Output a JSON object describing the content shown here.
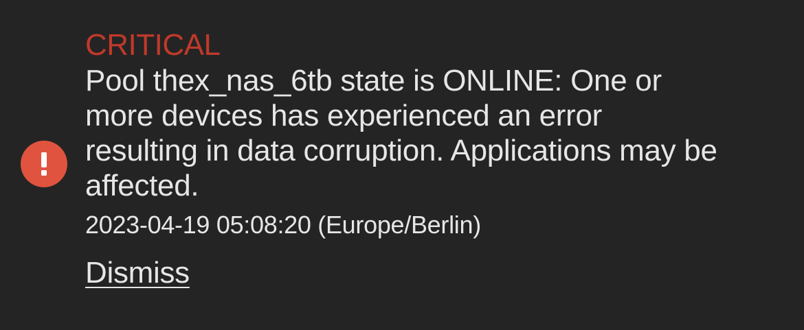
{
  "alert": {
    "level": "CRITICAL",
    "message": "Pool thex_nas_6tb state is ONLINE: One or more devices has experienced an error resulting in data corruption. Applications may be affected.",
    "timestamp": "2023-04-19 05:08:20 (Europe/Berlin)",
    "dismiss_label": "Dismiss",
    "icon": "error-circle-icon"
  },
  "colors": {
    "background": "#242424",
    "critical": "#c0392b",
    "icon_fill": "#e0533f",
    "text": "#e6e6e6"
  }
}
